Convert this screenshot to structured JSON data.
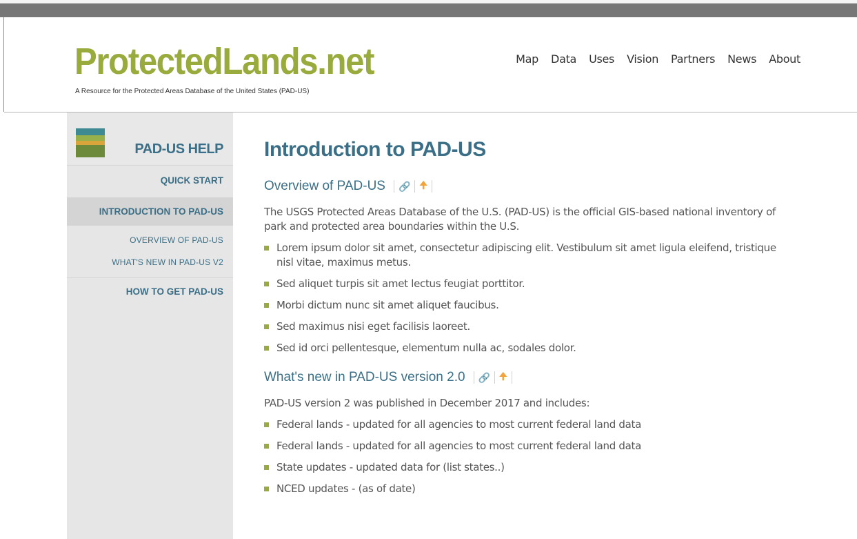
{
  "site": {
    "logo": "ProtectedLands.net",
    "tagline": "A Resource for the Protected Areas Database of the United States (PAD-US)"
  },
  "nav": [
    "Map",
    "Data",
    "Uses",
    "Vision",
    "Partners",
    "News",
    "About"
  ],
  "sidebar": {
    "title": "PAD-US HELP",
    "quick_start": "QUICK START",
    "intro": "INTRODUCTION TO PAD-US",
    "overview": "OVERVIEW OF PAD-US",
    "whats_new": "WHAT'S NEW IN PAD-US V2",
    "how_to_get": "HOW TO GET PAD-US"
  },
  "main": {
    "title": "Introduction to PAD-US",
    "section1": {
      "heading": "Overview of PAD-US",
      "paragraph": "The USGS Protected Areas Database of the U.S. (PAD-US) is the official GIS-based national inventory of park and protected area boundaries within the U.S.",
      "bullets": [
        "Lorem ipsum dolor sit amet, consectetur adipiscing elit. Vestibulum sit amet ligula eleifend, tristique nisl vitae, maximus metus.",
        "Sed aliquet turpis sit amet lectus feugiat porttitor.",
        "Morbi dictum nunc sit amet aliquet faucibus.",
        "Sed maximus nisi eget facilisis laoreet.",
        "Sed id orci pellentesque, elementum nulla ac, sodales dolor."
      ]
    },
    "section2": {
      "heading": "What's new in PAD-US version 2.0",
      "paragraph": "PAD-US version 2 was published in December 2017 and includes:",
      "bullets": [
        "Federal lands - updated for all agencies to most current federal land data",
        "Federal lands - updated for all agencies to most current federal land data",
        "State updates - updated data for (list states..)",
        "NCED updates - (as of date)"
      ]
    }
  },
  "colors": {
    "brand_green": "#98ab3c",
    "heading_blue": "#3a6f87",
    "icon_orange": "#f0a43a"
  },
  "icons": {
    "link": "link-icon",
    "up": "arrow-up-icon"
  }
}
